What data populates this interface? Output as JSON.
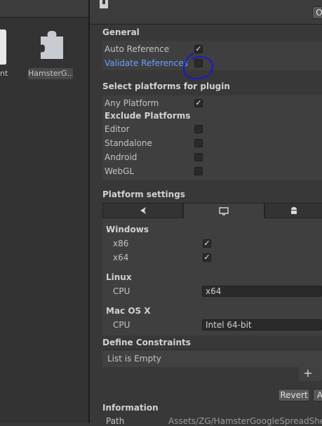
{
  "project": {
    "assets": [
      {
        "label": "nt"
      },
      {
        "label": "HamsterG..."
      }
    ]
  },
  "inspector": {
    "header_button": "O",
    "general": {
      "title": "General",
      "auto_reference": {
        "label": "Auto Reference",
        "checked": true
      },
      "validate_references": {
        "label": "Validate References",
        "checked": false
      }
    },
    "platforms": {
      "title": "Select platforms for plugin",
      "any_platform": {
        "label": "Any Platform",
        "checked": true
      },
      "exclude_title": "Exclude Platforms",
      "exclude": [
        {
          "label": "Editor",
          "checked": false
        },
        {
          "label": "Standalone",
          "checked": false
        },
        {
          "label": "Android",
          "checked": false
        },
        {
          "label": "WebGL",
          "checked": false
        }
      ]
    },
    "platform_settings": {
      "title": "Platform settings",
      "tabs": [
        {
          "icon": "unity-icon",
          "active": false
        },
        {
          "icon": "monitor-icon",
          "active": true
        },
        {
          "icon": "android-icon",
          "active": false
        }
      ],
      "windows": {
        "title": "Windows",
        "x86": {
          "label": "x86",
          "checked": true
        },
        "x64": {
          "label": "x64",
          "checked": true
        }
      },
      "linux": {
        "title": "Linux",
        "cpu_label": "CPU",
        "cpu_value": "x64"
      },
      "mac": {
        "title": "Mac OS X",
        "cpu_label": "CPU",
        "cpu_value": "Intel 64-bit"
      }
    },
    "define_constraints": {
      "title": "Define Constraints",
      "empty_text": "List is Empty",
      "add": "+"
    },
    "buttons": {
      "revert": "Revert",
      "apply": "A"
    },
    "information": {
      "title": "Information",
      "path_label": "Path",
      "path_value": "Assets/ZG/HamsterGoogleSpreadSheet"
    }
  },
  "colors": {
    "annotation": "#1a1acc",
    "link": "#6aa0ff"
  }
}
